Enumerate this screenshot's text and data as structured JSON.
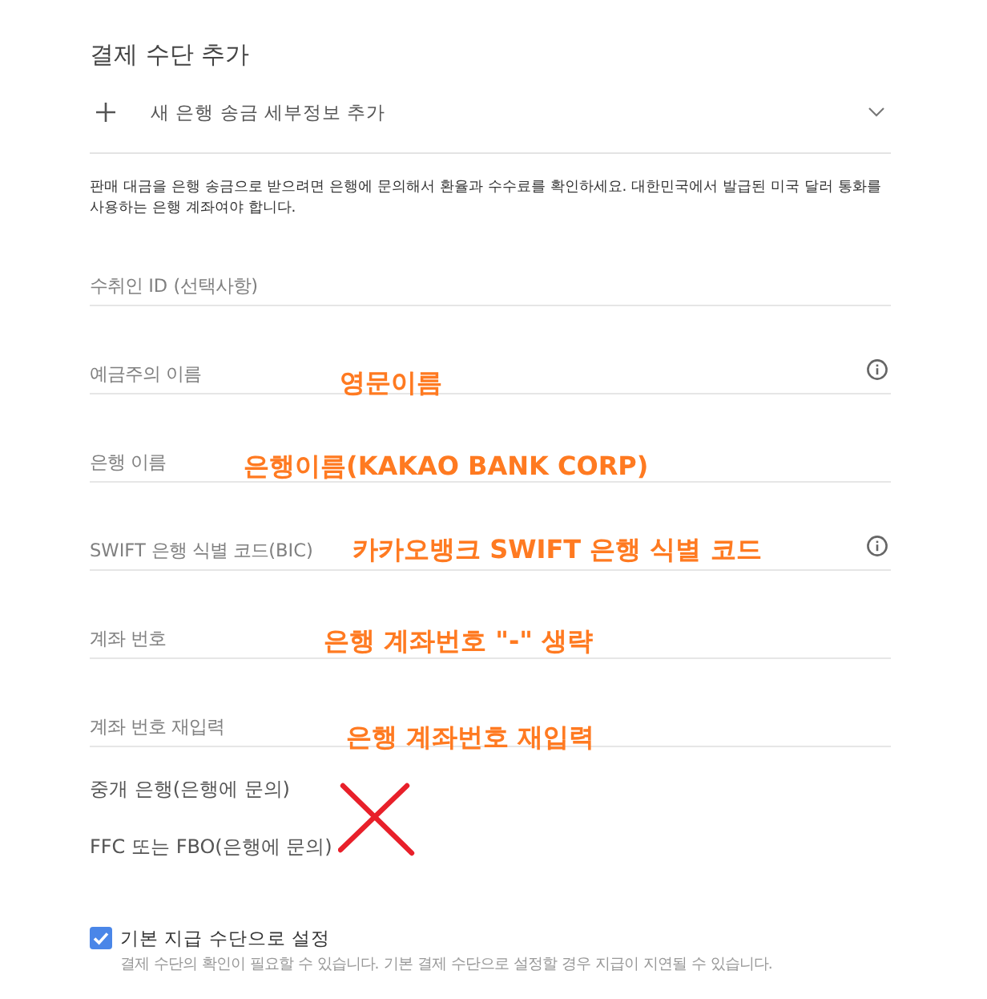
{
  "title": "결제 수단 추가",
  "add_bank": {
    "label": "새 은행 송금 세부정보 추가",
    "expanded": false
  },
  "description": "판매 대금을 은행 송금으로 받으려면 은행에 문의해서 환율과 수수료를 확인하세요. 대한민국에서 발급된 미국 달러 통화를 사용하는 은행 계좌여야 합니다.",
  "fields": [
    {
      "placeholder": "수취인 ID (선택사항)",
      "info": false
    },
    {
      "placeholder": "예금주의 이름",
      "info": true,
      "annotation": "영문이름"
    },
    {
      "placeholder": "은행 이름",
      "info": false,
      "annotation": "은행이름(KAKAO BANK CORP)"
    },
    {
      "placeholder": "SWIFT 은행 식별 코드(BIC)",
      "info": true,
      "annotation": "카카오뱅크 SWIFT 은행 식별 코드"
    },
    {
      "placeholder": "계좌 번호",
      "info": false,
      "annotation": "은행 계좌번호 \"-\" 생략"
    },
    {
      "placeholder": "계좌 번호 재입력",
      "info": false,
      "annotation": "은행 계좌번호 재입력"
    }
  ],
  "intermediary": [
    "중개 은행(은행에 문의)",
    "FFC 또는 FBO(은행에 문의)"
  ],
  "default_payment": {
    "label": "기본 지급 수단으로 설정",
    "checked": true,
    "note": "결제 수단의 확인이 필요할 수 있습니다. 기본 결제 수단으로 설정할 경우 지급이 지연될 수 있습니다."
  }
}
